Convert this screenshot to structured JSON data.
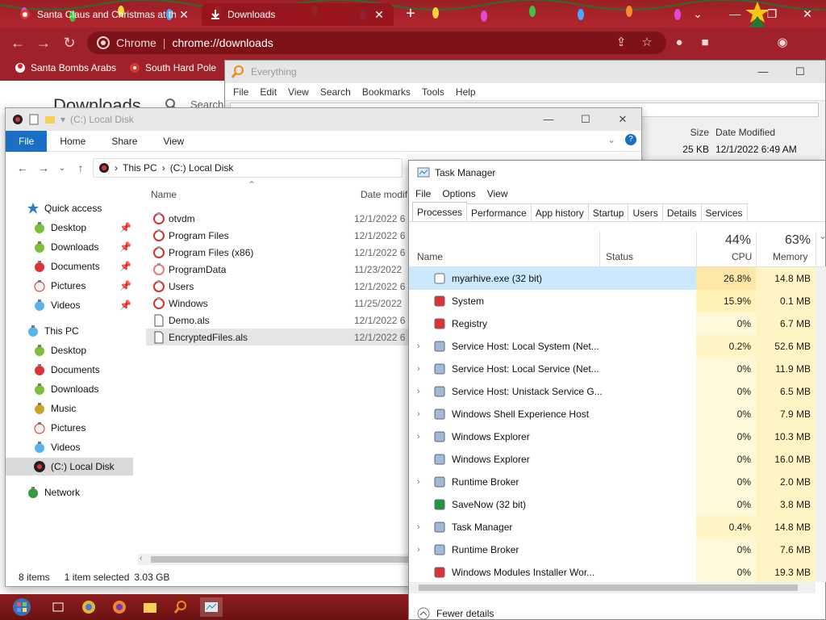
{
  "chrome": {
    "tabs": [
      {
        "title": "Santa Claus and Christmas at th"
      },
      {
        "title": "Downloads"
      }
    ],
    "omnibox": {
      "site": "Chrome",
      "url": "chrome://downloads"
    },
    "bookmarks": [
      {
        "label": "Santa Bombs Arabs"
      },
      {
        "label": "South Hard Pole"
      }
    ],
    "page": {
      "heading": "Downloads",
      "search_label": "Search"
    }
  },
  "everything": {
    "title": "Everything",
    "menu": [
      "File",
      "Edit",
      "View",
      "Search",
      "Bookmarks",
      "Tools",
      "Help"
    ],
    "columns": {
      "size": "Size",
      "date": "Date Modified"
    },
    "row": {
      "size": "25 KB",
      "date": "12/1/2022 6:49 AM"
    }
  },
  "explorer": {
    "title": "(C:) Local Disk",
    "ribbon": [
      "File",
      "Home",
      "Share",
      "View"
    ],
    "breadcrumbs": [
      "This PC",
      "(C:) Local Disk"
    ],
    "sidebar": [
      {
        "label": "Quick access"
      },
      {
        "label": "Desktop"
      },
      {
        "label": "Downloads"
      },
      {
        "label": "Documents"
      },
      {
        "label": "Pictures"
      },
      {
        "label": "Videos"
      },
      {
        "label": "This PC"
      },
      {
        "label": "Desktop"
      },
      {
        "label": "Documents"
      },
      {
        "label": "Downloads"
      },
      {
        "label": "Music"
      },
      {
        "label": "Pictures"
      },
      {
        "label": "Videos"
      },
      {
        "label": "(C:) Local Disk"
      },
      {
        "label": "Network"
      }
    ],
    "columns": {
      "name": "Name",
      "date": "Date modif"
    },
    "files": [
      {
        "name": "otvdm",
        "date": "12/1/2022 6"
      },
      {
        "name": "Program Files",
        "date": "12/1/2022 6"
      },
      {
        "name": "Program Files (x86)",
        "date": "12/1/2022 6"
      },
      {
        "name": "ProgramData",
        "date": "11/23/2022"
      },
      {
        "name": "Users",
        "date": "12/1/2022 6"
      },
      {
        "name": "Windows",
        "date": "11/25/2022"
      },
      {
        "name": "Demo.als",
        "date": "12/1/2022 6"
      },
      {
        "name": "EncryptedFiles.als",
        "date": "12/1/2022 6"
      }
    ],
    "status": {
      "items": "8 items",
      "selected": "1 item selected",
      "size": "3.03 GB"
    }
  },
  "taskmgr": {
    "title": "Task Manager",
    "menu": [
      "File",
      "Options",
      "View"
    ],
    "tabs": [
      "Processes",
      "Performance",
      "App history",
      "Startup",
      "Users",
      "Details",
      "Services"
    ],
    "headers": {
      "name": "Name",
      "status": "Status",
      "cpu_pct": "44%",
      "cpu": "CPU",
      "mem_pct": "63%",
      "mem": "Memory"
    },
    "processes": [
      {
        "name": "myarhive.exe (32 bit)",
        "cpu": "26.8%",
        "mem": "14.8 MB",
        "expand": false
      },
      {
        "name": "System",
        "cpu": "15.9%",
        "mem": "0.1 MB",
        "expand": false
      },
      {
        "name": "Registry",
        "cpu": "0%",
        "mem": "6.7 MB",
        "expand": false
      },
      {
        "name": "Service Host: Local System (Net...",
        "cpu": "0.2%",
        "mem": "52.6 MB",
        "expand": true
      },
      {
        "name": "Service Host: Local Service (Net...",
        "cpu": "0%",
        "mem": "11.9 MB",
        "expand": true
      },
      {
        "name": "Service Host: Unistack Service G...",
        "cpu": "0%",
        "mem": "6.5 MB",
        "expand": true
      },
      {
        "name": "Windows Shell Experience Host",
        "cpu": "0%",
        "mem": "7.9 MB",
        "expand": true
      },
      {
        "name": "Windows Explorer",
        "cpu": "0%",
        "mem": "10.3 MB",
        "expand": true
      },
      {
        "name": "Windows Explorer",
        "cpu": "0%",
        "mem": "16.0 MB",
        "expand": false
      },
      {
        "name": "Runtime Broker",
        "cpu": "0%",
        "mem": "2.0 MB",
        "expand": true
      },
      {
        "name": "SaveNow (32 bit)",
        "cpu": "0%",
        "mem": "3.8 MB",
        "expand": false
      },
      {
        "name": "Task Manager",
        "cpu": "0.4%",
        "mem": "14.8 MB",
        "expand": true
      },
      {
        "name": "Runtime Broker",
        "cpu": "0%",
        "mem": "7.6 MB",
        "expand": true
      },
      {
        "name": "Windows Modules Installer Wor...",
        "cpu": "0%",
        "mem": "19.3 MB",
        "expand": false
      }
    ],
    "footer": "Fewer details"
  },
  "colors": {
    "accent": "#1a6fc4",
    "chrome_red": "#9f2129",
    "selection": "#cce8ff",
    "cpu_heat": "#fff4c4"
  }
}
